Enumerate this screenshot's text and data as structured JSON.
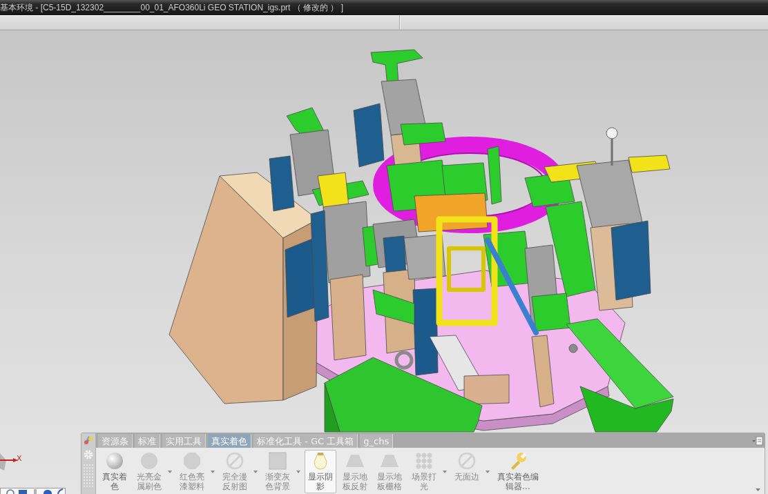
{
  "window": {
    "title": "基本环境 - [C5-15D_132302________00_01_AFO360Li GEO STATION_igs.prt （ 修改的 ） ]"
  },
  "viewport": {
    "axis_label": "X"
  },
  "toolbar": {
    "tabs": [
      {
        "label": "资源条",
        "selected": false
      },
      {
        "label": "标准",
        "selected": false
      },
      {
        "label": "实用工具",
        "selected": false
      },
      {
        "label": "真实着色",
        "selected": true
      },
      {
        "label": "标准化工具 - GC 工具箱",
        "selected": false
      },
      {
        "label": "g_chs",
        "selected": false
      }
    ],
    "buttons": [
      {
        "label": "真实着色",
        "disabled": false,
        "on": false,
        "dropdown": false
      },
      {
        "label": "光亮金属刷色",
        "disabled": true,
        "on": false,
        "dropdown": true
      },
      {
        "label": "红色亮漆塑料",
        "disabled": true,
        "on": false,
        "dropdown": true
      },
      {
        "label": "完全漫反射图",
        "disabled": true,
        "on": false,
        "dropdown": true
      },
      {
        "label": "渐变灰色背景",
        "disabled": true,
        "on": false,
        "dropdown": true
      },
      {
        "label": "显示阴影",
        "disabled": false,
        "on": true,
        "dropdown": false
      },
      {
        "label": "显示地板反射",
        "disabled": true,
        "on": false,
        "dropdown": false
      },
      {
        "label": "显示地板栅格",
        "disabled": true,
        "on": false,
        "dropdown": false
      },
      {
        "label": "场景打光",
        "disabled": true,
        "on": false,
        "dropdown": true
      },
      {
        "label": "无面边",
        "disabled": true,
        "on": false,
        "dropdown": true
      },
      {
        "label": "真实着色编辑器...",
        "disabled": false,
        "on": false,
        "dropdown": false
      }
    ]
  }
}
